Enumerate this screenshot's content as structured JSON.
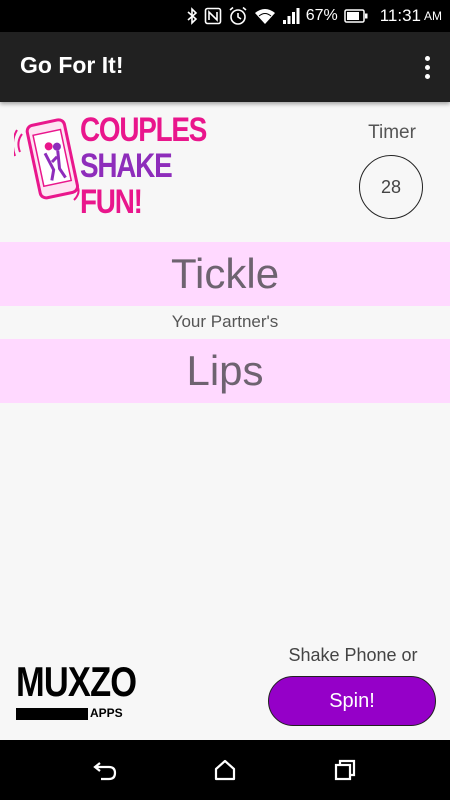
{
  "status_bar": {
    "battery_percent": "67%",
    "time": "11:31",
    "ampm": "AM",
    "icons": [
      "bluetooth-icon",
      "nfc-icon",
      "alarm-icon",
      "wifi-icon",
      "signal-icon",
      "battery-icon"
    ]
  },
  "app_bar": {
    "title": "Go For It!",
    "menu_icon": "overflow-menu-icon"
  },
  "logo": {
    "line1": "COUPLES",
    "line2": "SHAKE",
    "line3": "FUN!"
  },
  "timer": {
    "label": "Timer",
    "value": "28"
  },
  "result": {
    "action": "Tickle",
    "connector": "Your Partner's",
    "body_part": "Lips"
  },
  "footer": {
    "brand": "MUXZO",
    "brand_sub": "APPS",
    "shake_hint": "Shake Phone or",
    "spin_label": "Spin!"
  },
  "colors": {
    "band_bg": "#ffd9ff",
    "spin_bg": "#9500c8",
    "logo_pink": "#e9168c",
    "logo_purple": "#8e2dbb"
  },
  "nav_bar": {
    "icons": [
      "back-icon",
      "home-icon",
      "recents-icon"
    ]
  }
}
